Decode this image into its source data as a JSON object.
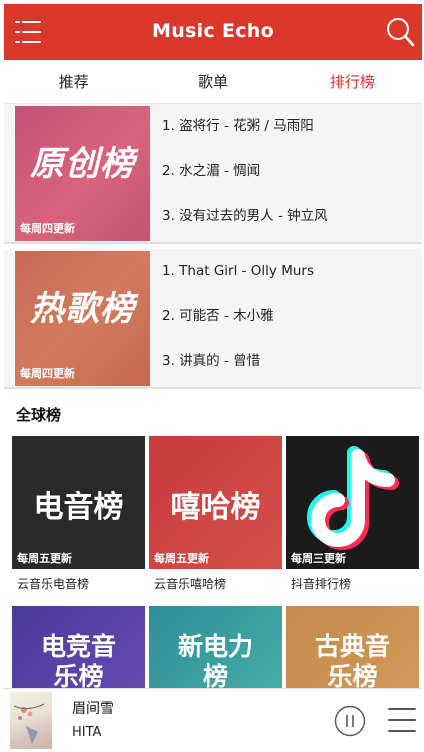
{
  "app": {
    "title": "Music Echo"
  },
  "icons": {
    "menu": "menu-icon",
    "search": "search-icon",
    "pause": "pause-icon",
    "playlist": "playlist-icon"
  },
  "colors": {
    "brand": "#d9382b",
    "active_tab": "#e03030"
  },
  "tabs": [
    {
      "label": "推荐"
    },
    {
      "label": "歌单"
    },
    {
      "label": "排行榜",
      "active": true
    }
  ],
  "official_charts": [
    {
      "art": "原创榜",
      "update": "每周四更新",
      "songs": [
        "1. 盗将行 - 花粥 / 马雨阳",
        "2. 水之湄 - 惆闻",
        "3. 没有过去的男人 - 钟立风"
      ]
    },
    {
      "art": "热歌榜",
      "update": "每周四更新",
      "songs": [
        "1. That Girl - Olly Murs",
        "2. 可能否 - 木小雅",
        "3. 讲真的 - 曾惜"
      ]
    }
  ],
  "global_section": {
    "title": "全球榜"
  },
  "global_charts": [
    {
      "art": "电音榜",
      "update": "每周五更新",
      "name": "云音乐电音榜"
    },
    {
      "art": "嘻哈榜",
      "update": "每周五更新",
      "name": "云音乐嘻哈榜"
    },
    {
      "art": "",
      "update": "每周三更新",
      "name": "抖音排行榜"
    },
    {
      "art": "电竞音乐榜",
      "update": "",
      "name": ""
    },
    {
      "art": "新电力榜",
      "update": "",
      "name": ""
    },
    {
      "art": "古典音乐榜",
      "update": "",
      "name": ""
    }
  ],
  "player": {
    "song": "眉间雪",
    "artist": "HITA"
  }
}
